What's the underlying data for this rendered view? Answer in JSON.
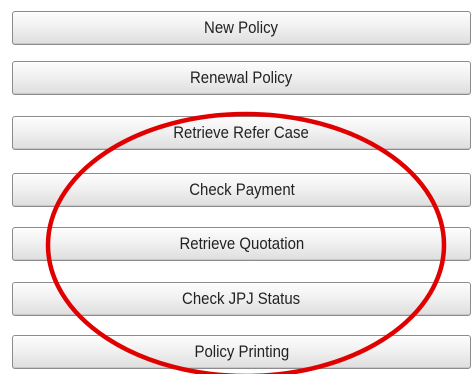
{
  "menu": {
    "buttons": [
      {
        "label": "New Policy"
      },
      {
        "label": "Renewal Policy"
      },
      {
        "label": "Retrieve Refer Case"
      },
      {
        "label": "Check Payment"
      },
      {
        "label": "Retrieve Quotation"
      },
      {
        "label": "Check JPJ Status"
      },
      {
        "label": "Policy Printing"
      }
    ]
  },
  "annotation": {
    "shape": "ellipse",
    "color": "#e00000",
    "highlighted_items": [
      "Retrieve Refer Case",
      "Check Payment",
      "Retrieve Quotation",
      "Check JPJ Status",
      "Policy Printing"
    ]
  }
}
